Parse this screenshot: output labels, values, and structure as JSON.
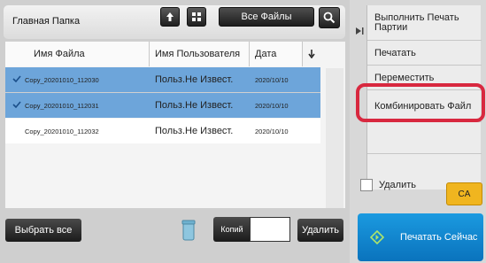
{
  "header": {
    "folder_title": "Главная Папка",
    "files_filter": "Все Файлы"
  },
  "table": {
    "columns": {
      "file_name": "Имя Файла",
      "user_name": "Имя Пользователя",
      "date": "Дата"
    },
    "rows": [
      {
        "file": "Copy_20201010_112030",
        "user": "Польз.Не Извест.",
        "date": "2020/10/10",
        "selected": true
      },
      {
        "file": "Copy_20201010_112031",
        "user": "Польз.Не Извест.",
        "date": "2020/10/10",
        "selected": true
      },
      {
        "file": "Copy_20201010_112032",
        "user": "Польз.Не Извест.",
        "date": "2020/10/10",
        "selected": false
      }
    ]
  },
  "bottom": {
    "select_all": "Выбрать все",
    "copies_label": "Копий",
    "copies_value": "",
    "delete": "Удалить"
  },
  "menu": {
    "items": [
      "Выполнить Печать Партии",
      "Печатать",
      "Переместить",
      "Комбинировать Файл"
    ],
    "delete_checkbox": "Удалить",
    "ca": "CA",
    "print_now": "Печатать Сейчас"
  },
  "colors": {
    "selected_row": "#6da5da",
    "highlight_ring": "#d8283f",
    "ca_button": "#f0b51f",
    "print_now": "#0a73bd"
  },
  "icons": [
    "up-arrow-icon",
    "grid-view-icon",
    "search-icon",
    "sort-down-icon",
    "checkmark-icon",
    "trash-bin-icon",
    "collapse-arrow-icon",
    "diamond-arrow-icon"
  ]
}
